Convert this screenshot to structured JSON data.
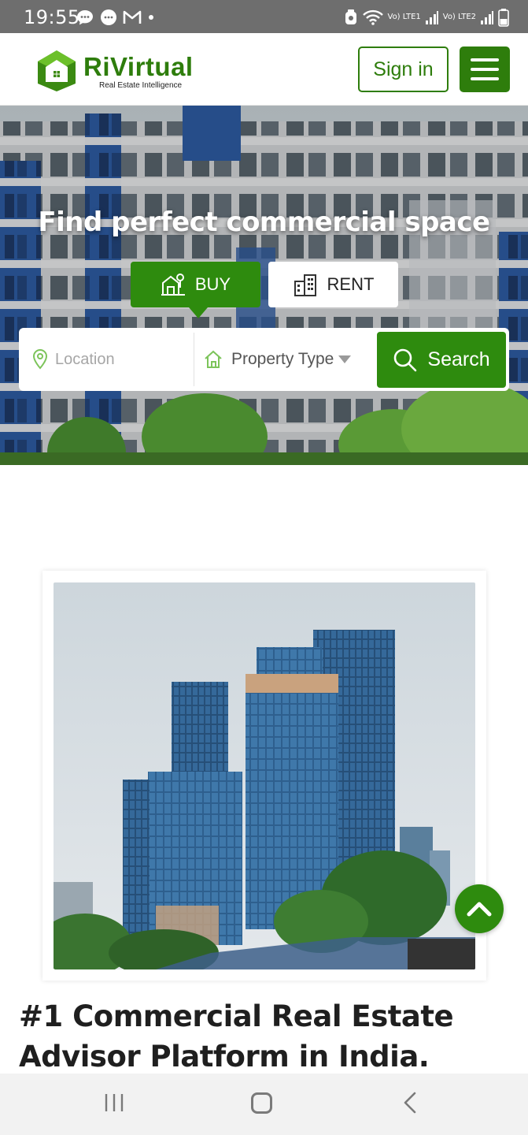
{
  "status_bar": {
    "time": "19:55",
    "net1": "Vo) LTE1",
    "net2": "Vo) LTE2"
  },
  "header": {
    "brand": "RiVirtual",
    "tagline": "Real Estate Intelligence",
    "signin_label": "Sign in",
    "accent_color": "#2e7d0c"
  },
  "hero": {
    "title": "Find perfect commercial space",
    "tabs": [
      {
        "label": "BUY",
        "selected": true
      },
      {
        "label": "RENT",
        "selected": false
      }
    ],
    "search": {
      "location_placeholder": "Location",
      "property_type_value": "Property Type",
      "button_label": "Search"
    }
  },
  "main": {
    "headline": "#1 Commercial Real Estate Advisor Platform in India."
  }
}
